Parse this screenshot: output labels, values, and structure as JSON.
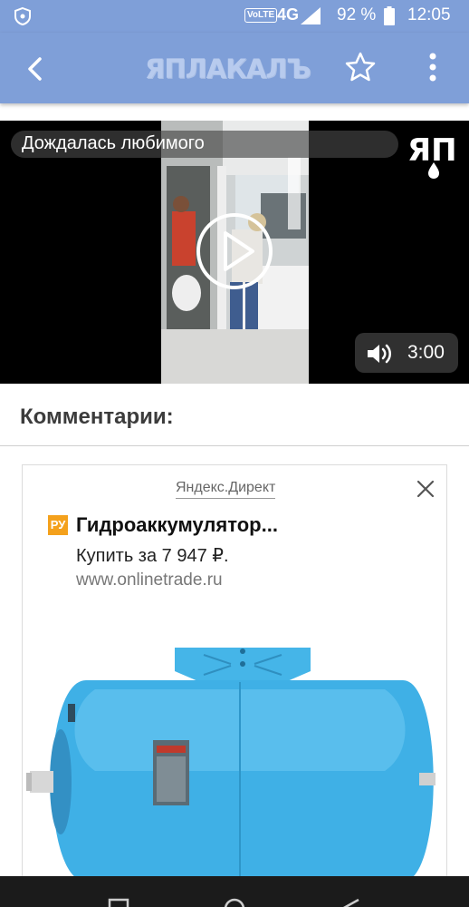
{
  "status_bar": {
    "network_badge": "VoLTE",
    "network_type": "4G",
    "battery_percent": "92 %",
    "time": "12:05"
  },
  "app_bar": {
    "logo_text": "ЯПЛАКАЛЪ",
    "icons": [
      "back-arrow-icon",
      "star-icon",
      "more-vert-icon"
    ]
  },
  "video": {
    "title": "Дождалась любимого",
    "duration": "3:00",
    "overlay_logo": "ЯП"
  },
  "comments": {
    "heading": "Комментарии:"
  },
  "ad": {
    "source": "Яндекс.Директ",
    "badge": "РУ",
    "title": "Гидроаккумулятор...",
    "price": "Купить за 7 947 ₽.",
    "url": "www.onlinetrade.ru"
  },
  "colors": {
    "app_bar": "#7f9fd8",
    "logo": "#b8cbee",
    "ad_badge": "#f4a11c",
    "tank": "#3fb0e6"
  }
}
